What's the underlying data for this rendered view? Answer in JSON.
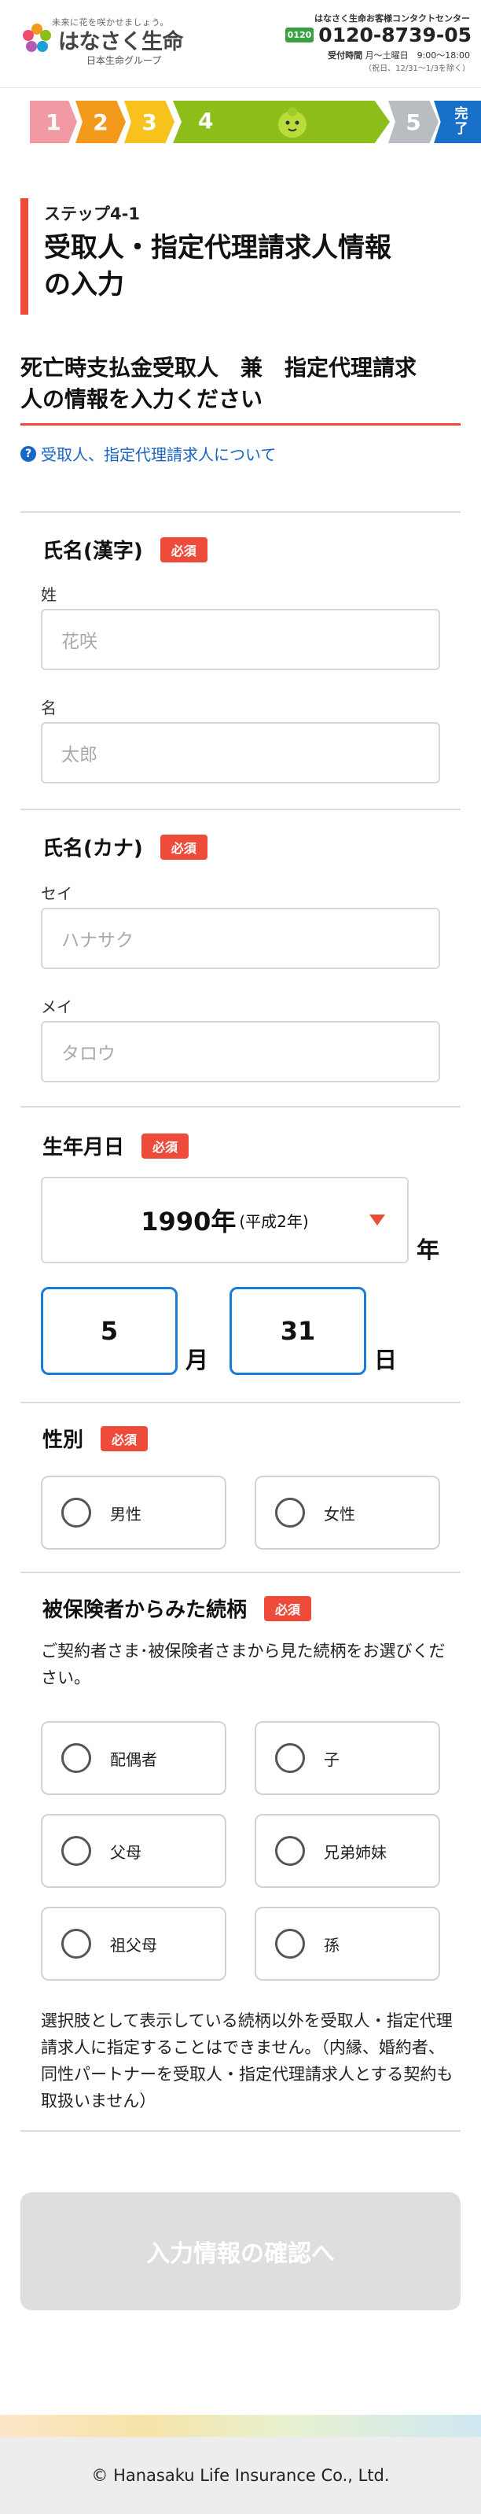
{
  "header": {
    "tagline": "未来に花を咲かせましょう。",
    "company_name": "はなさく生命",
    "group_label": "日本生命グループ",
    "contact_title": "はなさく生命お客様コンタクトセンター",
    "free_dial_badge": "0120",
    "phone": "0120-8739-05",
    "hours_label": "受付時間",
    "hours": "月～土曜日　9:00～18:00",
    "hours_note": "（祝日、12/31～1/3を除く）"
  },
  "progress": {
    "steps": [
      "1",
      "2",
      "3",
      "4",
      "5"
    ],
    "done_label_1": "完",
    "done_label_2": "了",
    "current_step": 4
  },
  "title": {
    "step": "ステップ4-1",
    "main_line1": "受取人・指定代理請求人情報",
    "main_line2": "の入力"
  },
  "subheading": {
    "line1": "死亡時支払金受取人　兼　指定代理請求",
    "line2": "人の情報を入力ください"
  },
  "about_link": "受取人、指定代理請求人について",
  "required_badge": "必須",
  "name_kanji": {
    "label": "氏名(漢字)",
    "last_label": "姓",
    "last_placeholder": "花咲",
    "first_label": "名",
    "first_placeholder": "太郎"
  },
  "name_kana": {
    "label": "氏名(カナ)",
    "last_label": "セイ",
    "last_placeholder": "ハナサク",
    "first_label": "メイ",
    "first_placeholder": "タロウ"
  },
  "birthdate": {
    "label": "生年月日",
    "year_value": "1990年",
    "year_era": "(平成2年)",
    "year_unit": "年",
    "month_value": "5",
    "month_unit": "月",
    "day_value": "31",
    "day_unit": "日"
  },
  "gender": {
    "label": "性別",
    "options": [
      "男性",
      "女性"
    ]
  },
  "relationship": {
    "label": "被保険者からみた続柄",
    "description": "ご契約者さま･被保険者さまから見た続柄をお選びください。",
    "options": [
      "配偶者",
      "子",
      "父母",
      "兄弟姉妹",
      "祖父母",
      "孫"
    ],
    "note": "選択肢として表示している続柄以外を受取人・指定代理請求人に指定することはできません。（内縁、婚約者、同性パートナーを受取人・指定代理請求人とする契約も取扱いません）"
  },
  "confirm_button": "入力情報の確認へ",
  "footer": {
    "copyright": "© Hanasaku Life Insurance Co., Ltd."
  },
  "colors": {
    "accent_red": "#ef4b3b",
    "link_blue": "#1a64c6",
    "step_green": "#8dbd19",
    "step_done_blue": "#1970c9"
  }
}
